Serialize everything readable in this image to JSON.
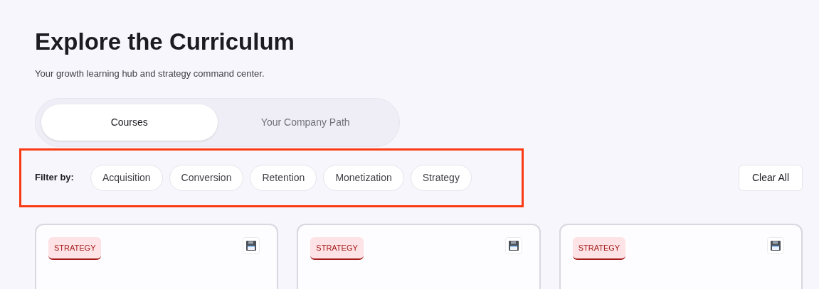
{
  "header": {
    "title": "Explore the Curriculum",
    "subtitle": "Your growth learning hub and strategy command center."
  },
  "tabs": [
    {
      "label": "Courses",
      "selected": true
    },
    {
      "label": "Your Company Path",
      "selected": false
    }
  ],
  "filter_bar": {
    "highlighted": true,
    "label": "Filter by:",
    "chips": [
      {
        "label": "Acquisition",
        "selected": false
      },
      {
        "label": "Conversion",
        "selected": false
      },
      {
        "label": "Retention",
        "selected": false
      },
      {
        "label": "Monetization",
        "selected": false
      },
      {
        "label": "Strategy",
        "selected": false
      }
    ],
    "clear_button": "Clear All"
  },
  "courses": [
    {
      "tag": "STRATEGY"
    },
    {
      "tag": "STRATEGY"
    },
    {
      "tag": "STRATEGY"
    }
  ]
}
